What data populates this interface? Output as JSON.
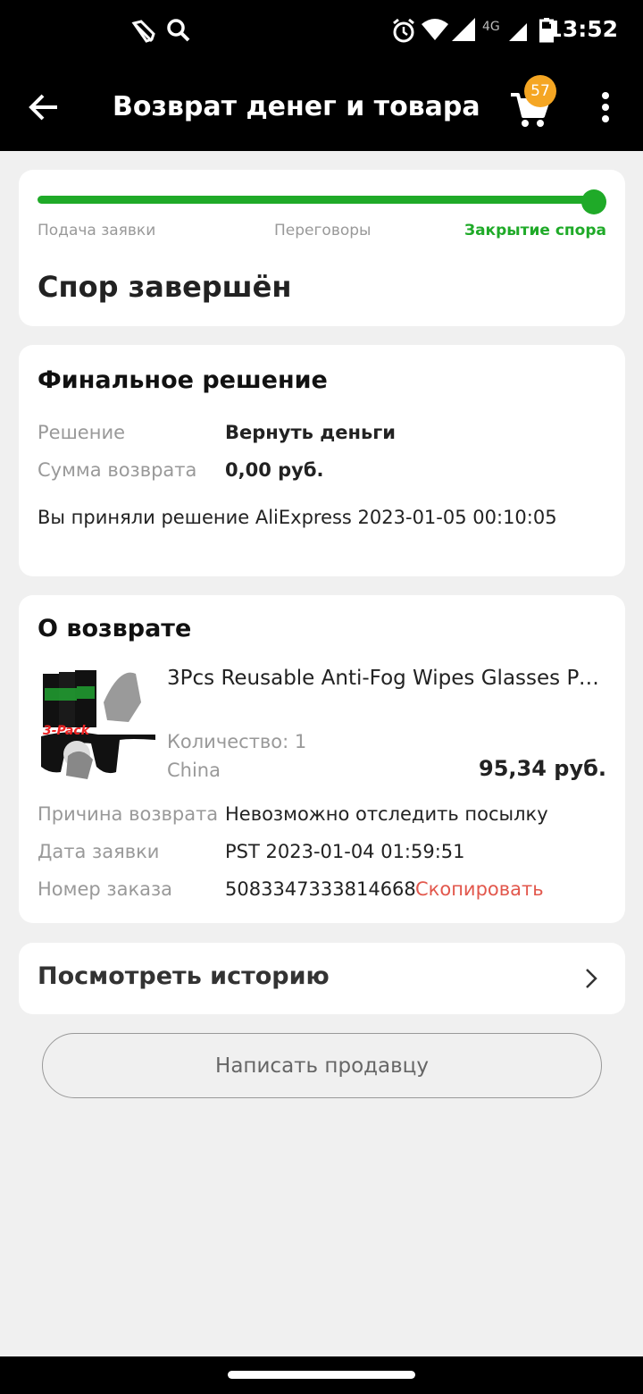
{
  "status_bar": {
    "time": "13:52",
    "network": "4G"
  },
  "app_bar": {
    "title": "Возврат денег и товара",
    "cart_count": "57"
  },
  "progress": {
    "steps": [
      "Подача заявки",
      "Переговоры",
      "Закрытие спора"
    ],
    "active_step": 2,
    "completion": 1.0
  },
  "status_heading": "Спор завершён",
  "final_decision": {
    "heading": "Финальное решение",
    "decision_label": "Решение",
    "decision_value": "Вернуть деньги",
    "amount_label": "Сумма возврата",
    "amount_value": "0,00 руб.",
    "note": "Вы приняли решение AliExpress 2023-01-05 00:10:05"
  },
  "about_return": {
    "heading": "О возврате",
    "product": {
      "title": "3Pcs Reusable Anti-Fog Wipes Glasses Pr...",
      "quantity": "Количество: 1",
      "origin": "China",
      "price": "95,34 руб.",
      "image_badge": "3-Pack"
    },
    "reason_label": "Причина возврата",
    "reason_value": "Невозможно отследить посылку",
    "date_label": "Дата заявки",
    "date_value": "PST 2023-01-04 01:59:51",
    "order_label": "Номер заказа",
    "order_value": "5083347333814668",
    "copy_label": "Скопировать"
  },
  "history": {
    "title": "Посмотреть историю"
  },
  "contact_button": "Написать продавцу",
  "colors": {
    "accent_green": "#1faa28",
    "link_red": "#e2574c",
    "badge_orange": "#f5a623"
  }
}
